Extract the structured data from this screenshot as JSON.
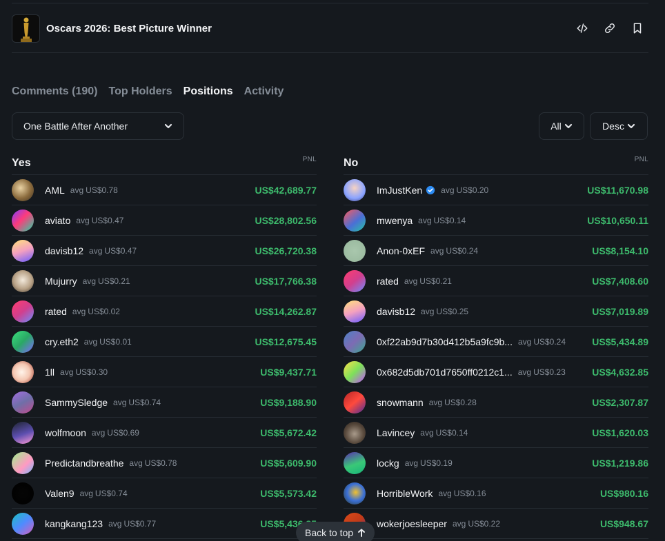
{
  "market": {
    "title": "Oscars 2026: Best Picture Winner",
    "icon": "oscar-statuette"
  },
  "header_actions": [
    "embed-code-icon",
    "link-icon",
    "bookmark-icon"
  ],
  "tabs": [
    "Comments (190)",
    "Top Holders",
    "Positions",
    "Activity"
  ],
  "active_tab": "Positions",
  "filters": {
    "outcome": "One Battle After Another",
    "side": "All",
    "sort": "Desc"
  },
  "pnl_label": "PNL",
  "avg_prefix": "avg",
  "colors": {
    "background": "#15191e",
    "pnl_positive": "#3dba6c",
    "muted_text": "#858d97",
    "verified": "#2c8cf4"
  },
  "yes": {
    "title": "Yes",
    "rows": [
      {
        "name": "AML",
        "avg": "US$0.78",
        "pnl": "US$42,689.77"
      },
      {
        "name": "aviato",
        "avg": "US$0.47",
        "pnl": "US$28,802.56"
      },
      {
        "name": "davisb12",
        "avg": "US$0.47",
        "pnl": "US$26,720.38"
      },
      {
        "name": "Mujurry",
        "avg": "US$0.21",
        "pnl": "US$17,766.38"
      },
      {
        "name": "rated",
        "avg": "US$0.02",
        "pnl": "US$14,262.87"
      },
      {
        "name": "cry.eth2",
        "avg": "US$0.01",
        "pnl": "US$12,675.45"
      },
      {
        "name": "1ll",
        "avg": "US$0.30",
        "pnl": "US$9,437.71"
      },
      {
        "name": "SammySledge",
        "avg": "US$0.74",
        "pnl": "US$9,188.90"
      },
      {
        "name": "wolfmoon",
        "avg": "US$0.69",
        "pnl": "US$5,672.42"
      },
      {
        "name": "Predictandbreathe",
        "avg": "US$0.78",
        "pnl": "US$5,609.90"
      },
      {
        "name": "Valen9",
        "avg": "US$0.74",
        "pnl": "US$5,573.42"
      },
      {
        "name": "kangkang123",
        "avg": "US$0.77",
        "pnl": "US$5,436.85"
      }
    ]
  },
  "no": {
    "title": "No",
    "rows": [
      {
        "name": "ImJustKen",
        "avg": "US$0.20",
        "pnl": "US$11,670.98",
        "verified": true
      },
      {
        "name": "mwenya",
        "avg": "US$0.14",
        "pnl": "US$10,650.11"
      },
      {
        "name": "Anon-0xEF",
        "avg": "US$0.24",
        "pnl": "US$8,154.10"
      },
      {
        "name": "rated",
        "avg": "US$0.21",
        "pnl": "US$7,408.60"
      },
      {
        "name": "davisb12",
        "avg": "US$0.25",
        "pnl": "US$7,019.89"
      },
      {
        "name": "0xf22ab9d7b30d412b5a9fc9b...",
        "avg": "US$0.24",
        "pnl": "US$5,434.89"
      },
      {
        "name": "0x682d5db701d7650ff0212c1...",
        "avg": "US$0.23",
        "pnl": "US$4,632.85"
      },
      {
        "name": "snowmann",
        "avg": "US$0.28",
        "pnl": "US$2,307.87"
      },
      {
        "name": "Lavincey",
        "avg": "US$0.14",
        "pnl": "US$1,620.03"
      },
      {
        "name": "lockg",
        "avg": "US$0.19",
        "pnl": "US$1,219.86"
      },
      {
        "name": "HorribleWork",
        "avg": "US$0.16",
        "pnl": "US$980.16"
      },
      {
        "name": "wokerjoesleeper",
        "avg": "US$0.22",
        "pnl": "US$948.67"
      }
    ]
  },
  "back_to_top": "Back to top"
}
